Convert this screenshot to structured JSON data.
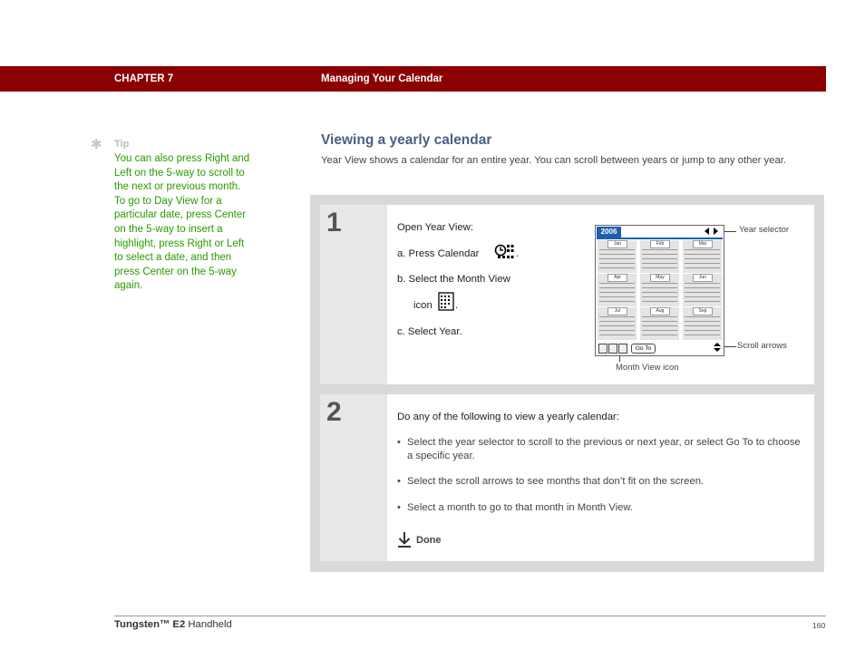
{
  "header": {
    "chapter": "CHAPTER 7",
    "title": "Managing Your Calendar",
    "bg_color": "#8b0000"
  },
  "tip": {
    "label": "Tip",
    "text": "You can also press Right and Left on the 5-way to scroll to the next or previous month. To go to Day View for a particular date, press Center on the 5-way to insert a highlight, press Right or Left to select a date, and then press Center on the 5-way again.",
    "color": "#2a9a00",
    "icon": "asterisk-icon"
  },
  "section": {
    "title": "Viewing a yearly calendar",
    "intro": "Year View shows a calendar for an entire year. You can scroll between years or jump to any other year."
  },
  "step1": {
    "number": "1",
    "lead": "Open Year View:",
    "a_prefix": "a.  Press Calendar",
    "a_suffix": ".",
    "b_line1": "b.  Select the Month View",
    "b_line2_prefix": "icon",
    "b_line2_suffix": ".",
    "c": "c.  Select Year.",
    "screen": {
      "year": "2006",
      "months": [
        "Jan",
        "Feb",
        "Mar",
        "Apr",
        "May",
        "Jun",
        "Jul",
        "Aug",
        "Sep"
      ],
      "goto": "Go To"
    },
    "callouts": {
      "year_selector": "Year selector",
      "scroll_arrows": "Scroll arrows",
      "month_view_icon": "Month View icon"
    }
  },
  "step2": {
    "number": "2",
    "lead": "Do any of the following to view a yearly calendar:",
    "bullet": "•",
    "items": [
      "Select the year selector to scroll to the previous or next year, or select Go To to choose a specific year.",
      "Select the scroll arrows to see months that don’t fit on the screen.",
      "Select a month to go to that month in Month View."
    ],
    "done": "Done"
  },
  "footer": {
    "product": "Tungsten™ E2",
    "suffix": " Handheld",
    "page": "160"
  }
}
